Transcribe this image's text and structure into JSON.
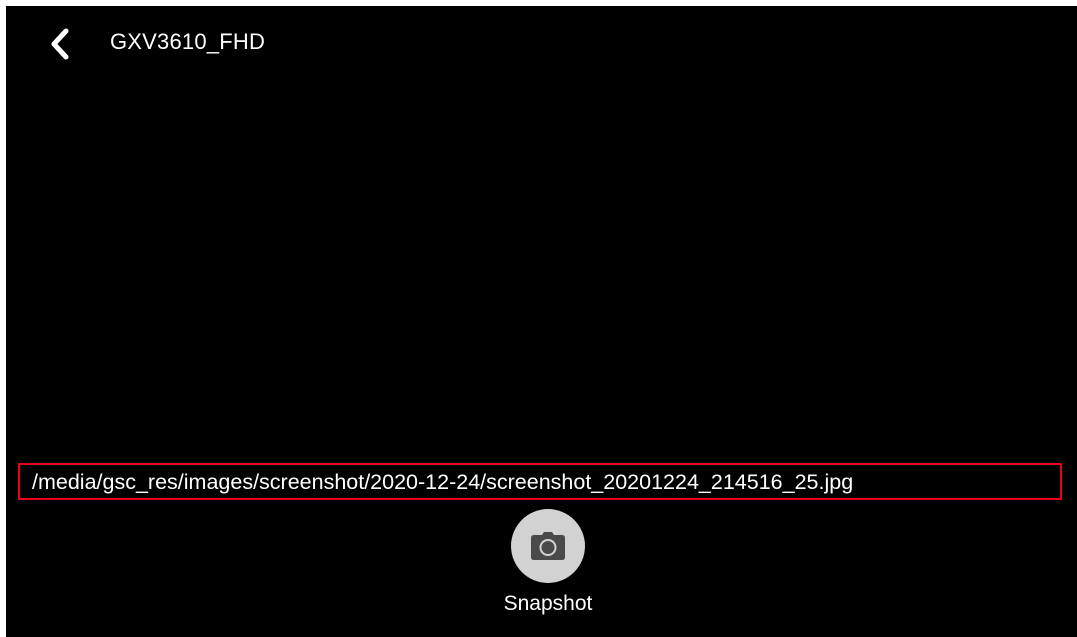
{
  "header": {
    "back_icon": "chevron-left-icon",
    "title": "GXV3610_FHD"
  },
  "notice": {
    "file_path": "/media/gsc_res/images/screenshot/2020-12-24/screenshot_20201224_214516_25.jpg",
    "highlight_color": "#e8001c"
  },
  "controls": {
    "snapshot": {
      "icon": "camera-icon",
      "label": "Snapshot"
    }
  },
  "colors": {
    "background": "#000000",
    "text": "#ffffff",
    "button_circle": "#d2d2d2",
    "icon": "#4a4a4a"
  }
}
